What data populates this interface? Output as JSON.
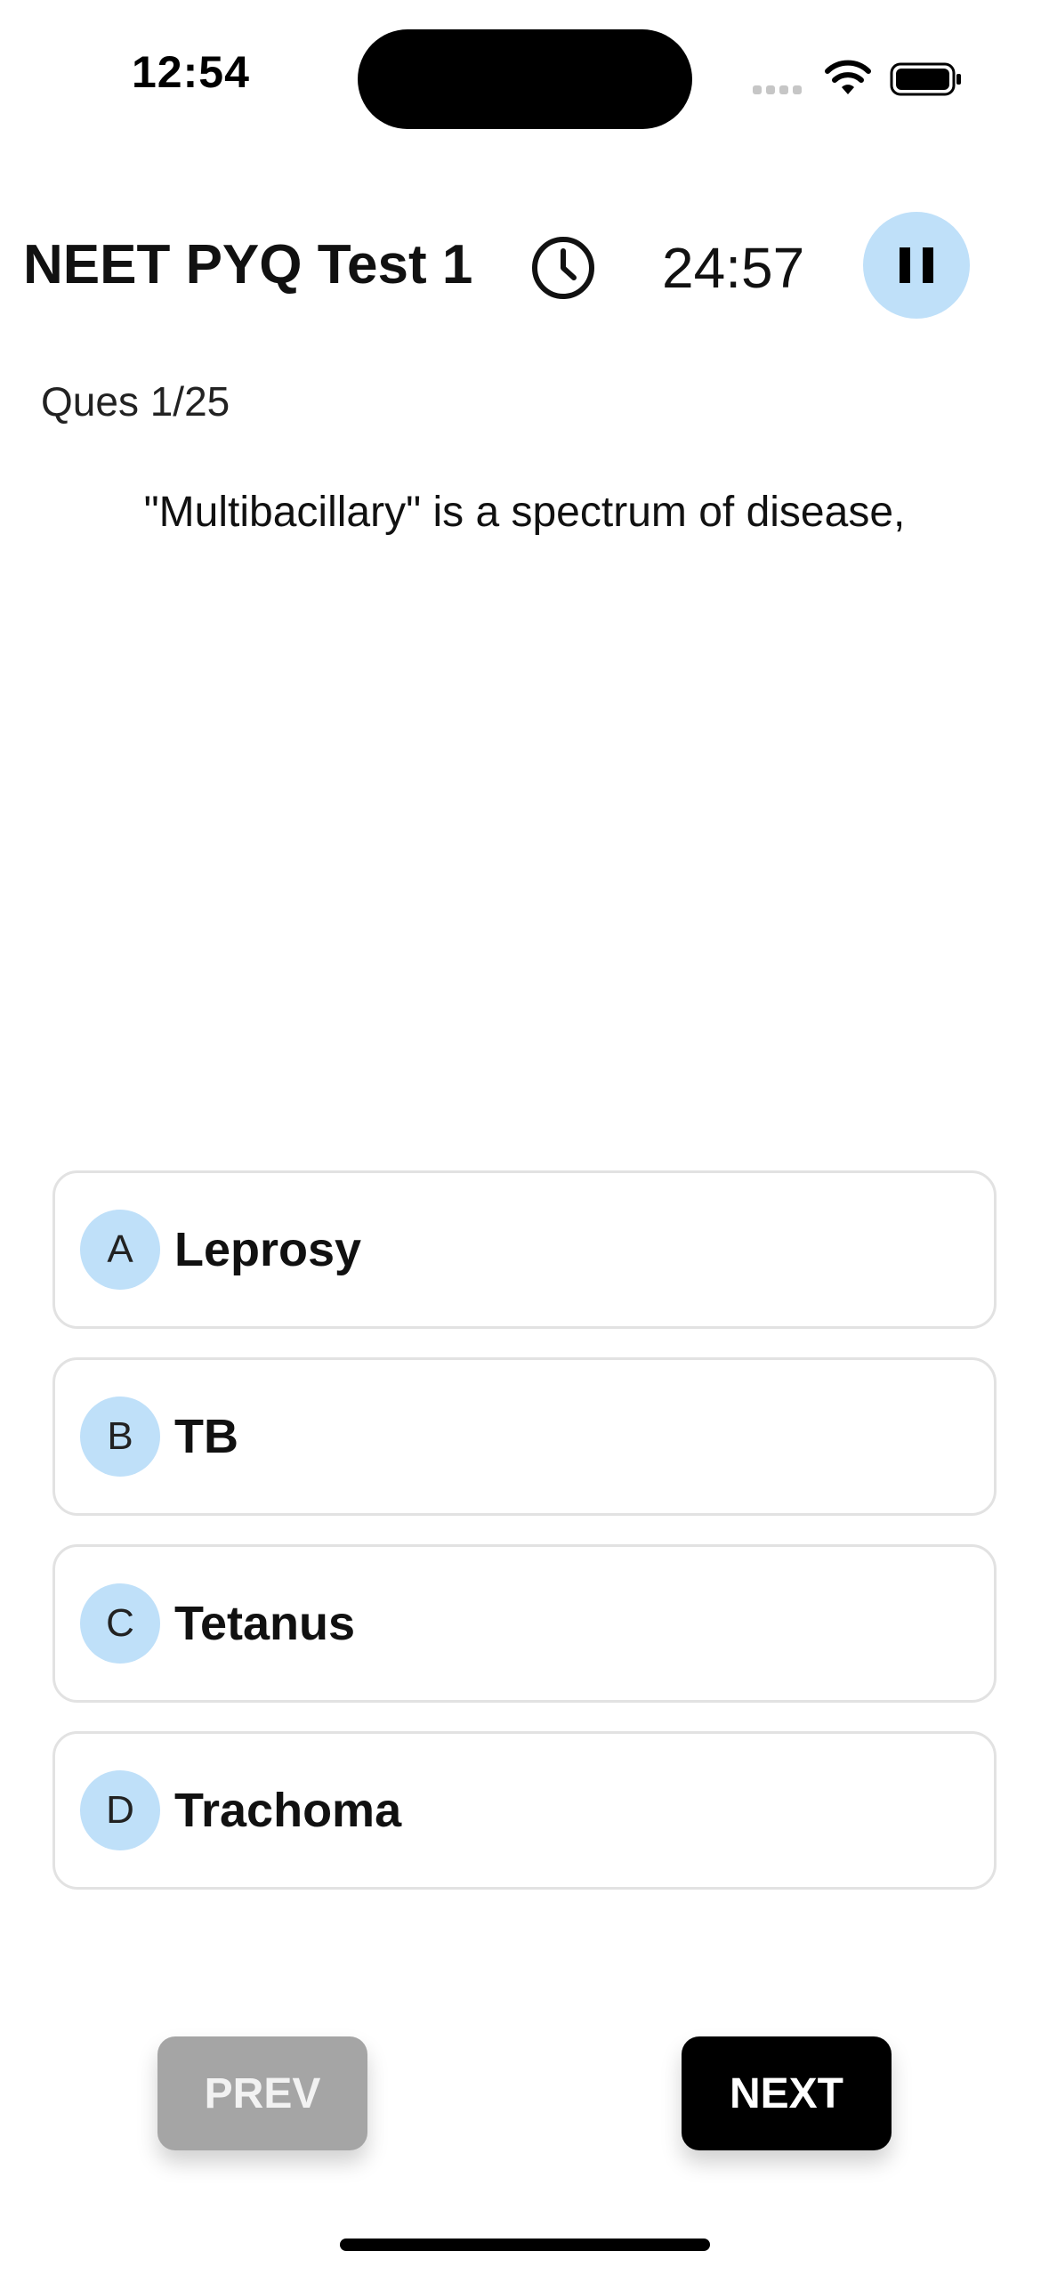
{
  "status_bar": {
    "time": "12:54"
  },
  "header": {
    "title": "NEET PYQ Test 1",
    "timer": "24:57",
    "clock_icon": "clock-icon",
    "pause_icon": "pause-icon"
  },
  "question": {
    "counter": "Ques 1/25",
    "text": "\"Multibacillary\" is a spectrum of disease,"
  },
  "options": [
    {
      "letter": "A",
      "label": "Leprosy"
    },
    {
      "letter": "B",
      "label": "TB"
    },
    {
      "letter": "C",
      "label": "Tetanus"
    },
    {
      "letter": "D",
      "label": "Trachoma"
    }
  ],
  "footer": {
    "prev_label": "PREV",
    "next_label": "NEXT"
  },
  "colors": {
    "accent": "#bfe0f9",
    "disabled_button": "#a5a5a5",
    "primary_button": "#000000"
  }
}
